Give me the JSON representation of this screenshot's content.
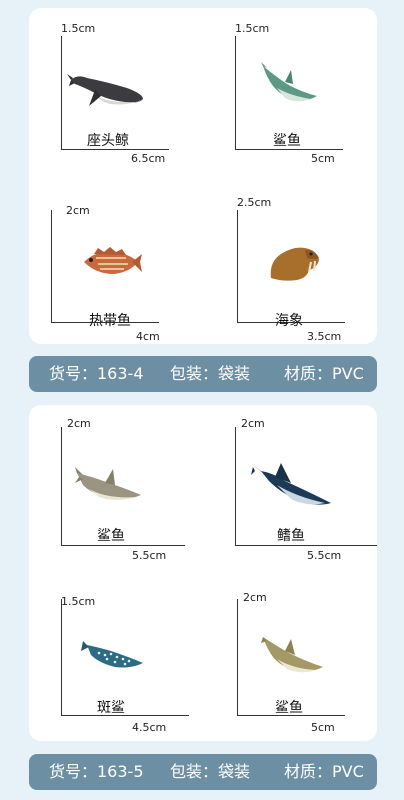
{
  "groups": [
    {
      "items": [
        {
          "name": "座头鲸",
          "height": "1.5cm",
          "length": "6.5cm",
          "icon": "humpback-whale-icon"
        },
        {
          "name": "鲨鱼",
          "height": "1.5cm",
          "length": "5cm",
          "icon": "shark-icon"
        },
        {
          "name": "热带鱼",
          "height": "2cm",
          "length": "4cm",
          "icon": "tropical-fish-icon"
        },
        {
          "name": "海象",
          "height": "2.5cm",
          "length": "3.5cm",
          "icon": "walrus-icon"
        }
      ],
      "info": {
        "item_no": "货号：163-4",
        "packaging": "包装：袋装",
        "material": "材质：PVC"
      }
    },
    {
      "items": [
        {
          "name": "鲨鱼",
          "height": "2cm",
          "length": "5.5cm",
          "icon": "shark-icon"
        },
        {
          "name": "鳍鱼",
          "height": "2cm",
          "length": "5.5cm",
          "icon": "swordfish-icon"
        },
        {
          "name": "斑鲨",
          "height": "1.5cm",
          "length": "4.5cm",
          "icon": "whale-shark-icon"
        },
        {
          "name": "鲨鱼",
          "height": "2cm",
          "length": "5cm",
          "icon": "shark-icon"
        }
      ],
      "info": {
        "item_no": "货号：163-5",
        "packaging": "包装：袋装",
        "material": "材质：PVC"
      }
    }
  ],
  "colors": {
    "background": "#e7f1f8",
    "card": "#ffffff",
    "info_bar": "#6d8fa3",
    "info_text": "#ffffff"
  }
}
